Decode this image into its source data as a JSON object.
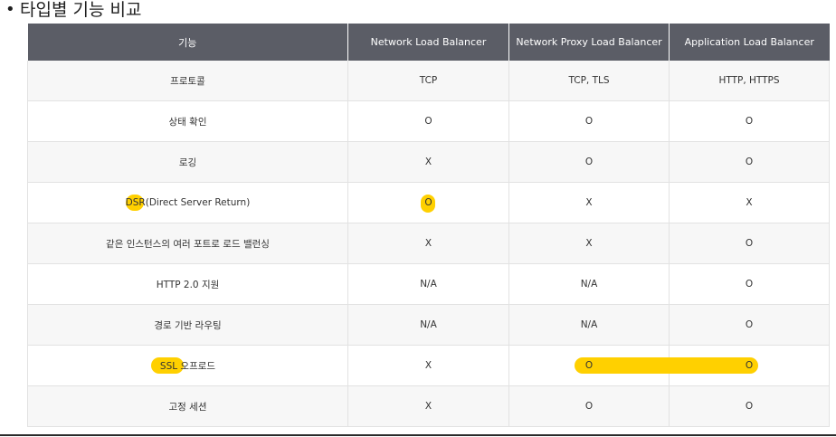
{
  "heading": {
    "bullet": "•",
    "title": "타입별 기능 비교"
  },
  "table": {
    "headers": [
      "기능",
      "Network Load Balancer",
      "Network Proxy Load Balancer",
      "Application Load Balancer"
    ],
    "rows": [
      [
        "프로토콜",
        "TCP",
        "TCP, TLS",
        "HTTP, HTTPS"
      ],
      [
        "상태 확인",
        "O",
        "O",
        "O"
      ],
      [
        "로깅",
        "X",
        "O",
        "O"
      ],
      [
        "DSR(Direct Server Return)",
        "O",
        "X",
        "X"
      ],
      [
        "같은 인스턴스의 여러 포트로 로드 밸런싱",
        "X",
        "X",
        "O"
      ],
      [
        "HTTP 2.0 지원",
        "N/A",
        "N/A",
        "O"
      ],
      [
        "경로 기반 라우팅",
        "N/A",
        "N/A",
        "O"
      ],
      [
        "SSL 오프로드",
        "X",
        "O",
        "O"
      ],
      [
        "고정 세션",
        "X",
        "O",
        "O"
      ]
    ]
  },
  "colors": {
    "header_bg": "#5b5d66",
    "highlight": "#ffd000",
    "row_alt": "#f7f7f7"
  }
}
